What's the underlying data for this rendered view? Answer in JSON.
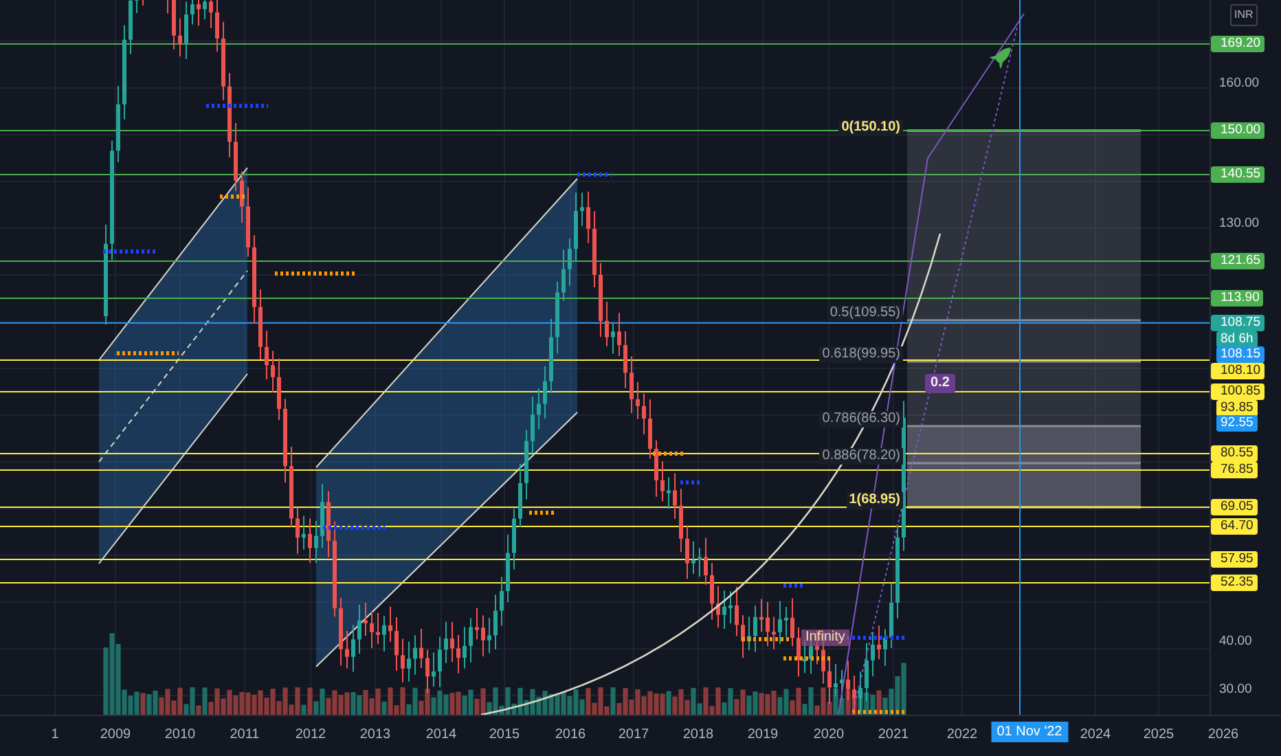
{
  "price_axis": {
    "currency": "INR",
    "ticks": [
      "160.00",
      "130.00",
      "40.00",
      "30.00"
    ],
    "labels": [
      {
        "text": "169.20",
        "color": "#4caf50",
        "line": true
      },
      {
        "text": "150.00",
        "color": "#4caf50",
        "line": true
      },
      {
        "text": "140.55",
        "color": "#4caf50",
        "line": true
      },
      {
        "text": "121.65",
        "color": "#4caf50",
        "line": true
      },
      {
        "text": "113.90",
        "color": "#4caf50",
        "line": true
      },
      {
        "text": "108.75",
        "color": "#26a69a",
        "line": true
      },
      {
        "text": "8d 6h",
        "color": "#26a69a",
        "line": false
      },
      {
        "text": "108.15",
        "color": "#2196f3",
        "line": false
      },
      {
        "text": "108.10",
        "color": "#ffeb3b",
        "line": true
      },
      {
        "text": "100.85",
        "color": "#ffeb3b",
        "line": true
      },
      {
        "text": "93.85",
        "color": "#ffeb3b",
        "line": false
      },
      {
        "text": "92.55",
        "color": "#2196f3",
        "line": false
      },
      {
        "text": "80.55",
        "color": "#ffeb3b",
        "line": true
      },
      {
        "text": "76.85",
        "color": "#ffeb3b",
        "line": true
      },
      {
        "text": "69.05",
        "color": "#ffeb3b",
        "line": true
      },
      {
        "text": "64.70",
        "color": "#ffeb3b",
        "line": true
      },
      {
        "text": "57.95",
        "color": "#ffeb3b",
        "line": true
      },
      {
        "text": "52.35",
        "color": "#ffeb3b",
        "line": true
      }
    ]
  },
  "time_axis": {
    "ticks": [
      "1",
      "2009",
      "2010",
      "2011",
      "2012",
      "2013",
      "2014",
      "2015",
      "2016",
      "2017",
      "2018",
      "2019",
      "2020",
      "2021",
      "2022",
      "2024",
      "2025",
      "2026"
    ],
    "crosshair_label": "01 Nov '22"
  },
  "chart": {
    "fib_labels": [
      "0(150.10)",
      "0.5(109.55)",
      "0.618(99.95)",
      "0.786(86.30)",
      "0.886(78.20)",
      "1(68.95)"
    ],
    "badge": "0.2",
    "note": "Infinity"
  }
}
